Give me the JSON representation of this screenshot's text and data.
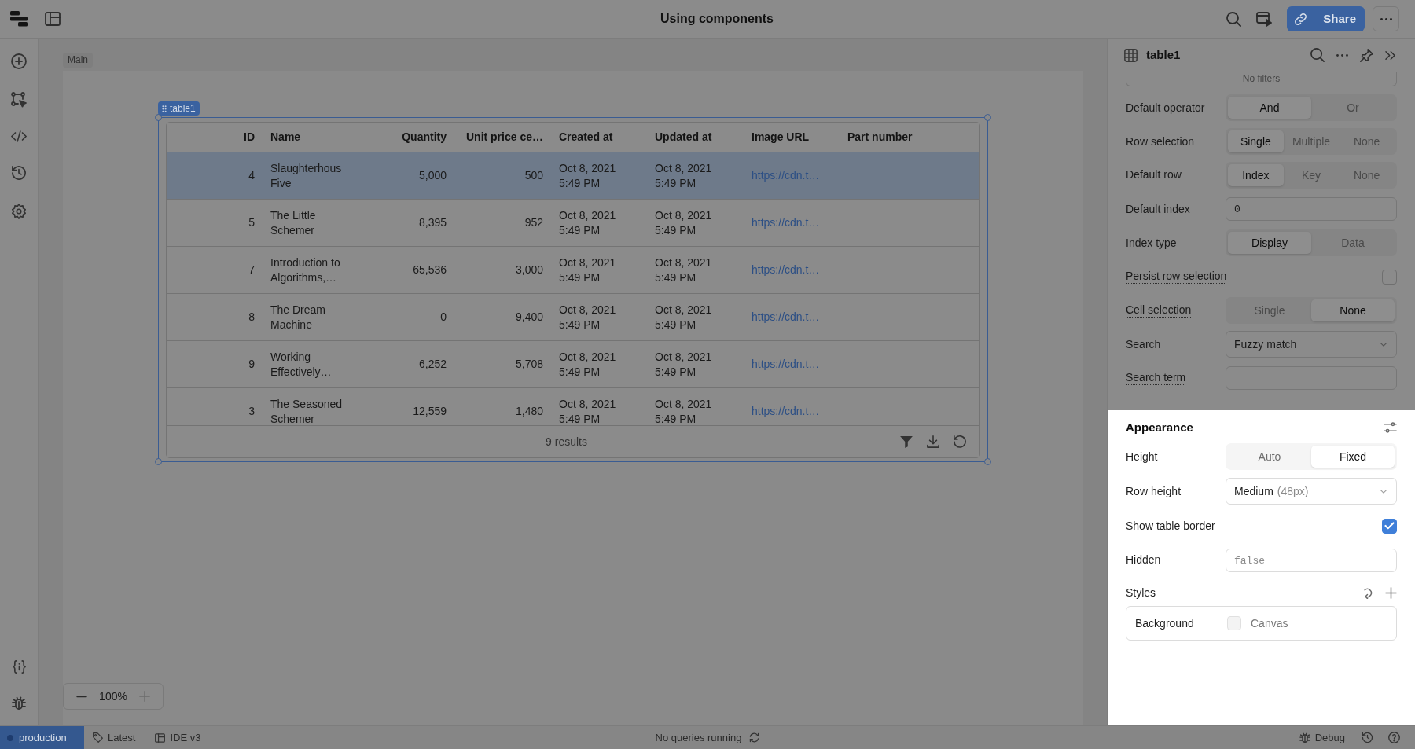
{
  "top_bar": {
    "title": "Using components",
    "share_button": "Share"
  },
  "canvas": {
    "frame_label": "Main",
    "zoom_level": "100%",
    "zoom_in_disabled": true
  },
  "table": {
    "tag": "table1",
    "columns": [
      {
        "label": "ID",
        "kind": "number"
      },
      {
        "label": "Name",
        "kind": "text"
      },
      {
        "label": "Quantity",
        "kind": "number"
      },
      {
        "label": "Unit price ce…",
        "kind": "number"
      },
      {
        "label": "Created at",
        "kind": "text"
      },
      {
        "label": "Updated at",
        "kind": "text"
      },
      {
        "label": "Image URL",
        "kind": "link"
      },
      {
        "label": "Part number",
        "kind": "text"
      }
    ],
    "rows": [
      {
        "selected": true,
        "cells": [
          "4",
          "Slaughterhous\nFive",
          "5,000",
          "500",
          "Oct 8, 2021\n5:49 PM",
          "Oct 8, 2021\n5:49 PM",
          "https://cdn.t…"
        ]
      },
      {
        "selected": false,
        "cells": [
          "5",
          "The Little\nSchemer",
          "8,395",
          "952",
          "Oct 8, 2021\n5:49 PM",
          "Oct 8, 2021\n5:49 PM",
          "https://cdn.t…"
        ]
      },
      {
        "selected": false,
        "cells": [
          "7",
          "Introduction to\nAlgorithms,…",
          "65,536",
          "3,000",
          "Oct 8, 2021\n5:49 PM",
          "Oct 8, 2021\n5:49 PM",
          "https://cdn.t…"
        ]
      },
      {
        "selected": false,
        "cells": [
          "8",
          "The Dream\nMachine",
          "0",
          "9,400",
          "Oct 8, 2021\n5:49 PM",
          "Oct 8, 2021\n5:49 PM",
          "https://cdn.t…"
        ]
      },
      {
        "selected": false,
        "cells": [
          "9",
          "Working\nEffectively…",
          "6,252",
          "5,708",
          "Oct 8, 2021\n5:49 PM",
          "Oct 8, 2021\n5:49 PM",
          "https://cdn.t…"
        ]
      },
      {
        "selected": false,
        "cells": [
          "3",
          "The Seasoned\nSchemer",
          "12,559",
          "1,480",
          "Oct 8, 2021\n5:49 PM",
          "Oct 8, 2021\n5:49 PM",
          "https://cdn.t…"
        ]
      }
    ],
    "footer": "9 results"
  },
  "inspector": {
    "title": "table1",
    "filters": "No filters",
    "settings": [
      {
        "kind": "segmented",
        "label": "Default operator",
        "dotted_underline": false,
        "options": [
          {
            "label": "And",
            "selected": true
          },
          {
            "label": "Or",
            "selected": false
          }
        ]
      },
      {
        "kind": "segmented",
        "label": "Row selection",
        "dotted_underline": false,
        "options": [
          {
            "label": "Single",
            "selected": true
          },
          {
            "label": "Multiple",
            "selected": false
          },
          {
            "label": "None",
            "selected": false
          }
        ]
      },
      {
        "kind": "segmented",
        "label": "Default row",
        "dotted_underline": true,
        "options": [
          {
            "label": "Index",
            "selected": true
          },
          {
            "label": "Key",
            "selected": false
          },
          {
            "label": "None",
            "selected": false
          }
        ]
      },
      {
        "kind": "input",
        "label": "Default index",
        "dotted_underline": false,
        "value": "0"
      },
      {
        "kind": "segmented",
        "label": "Index type",
        "dotted_underline": false,
        "options": [
          {
            "label": "Display",
            "selected": true
          },
          {
            "label": "Data",
            "selected": false
          }
        ]
      },
      {
        "kind": "checkbox",
        "label": "Persist row selection",
        "dotted_underline": true,
        "checked": false
      },
      {
        "kind": "segmented",
        "label": "Cell selection",
        "dotted_underline": true,
        "options": [
          {
            "label": "Single",
            "selected": false
          },
          {
            "label": "None",
            "selected": true
          }
        ]
      },
      {
        "kind": "select",
        "label": "Search",
        "dotted_underline": false,
        "value": "Fuzzy match"
      },
      {
        "kind": "input",
        "label": "Search term",
        "dotted_underline": true
      }
    ],
    "appearance": {
      "spotlight": true,
      "title": "Appearance",
      "settings": [
        {
          "kind": "segmented",
          "label": "Height",
          "dotted_underline": false,
          "options": [
            {
              "label": "Auto",
              "selected": false
            },
            {
              "label": "Fixed",
              "selected": true
            }
          ]
        },
        {
          "kind": "select",
          "label": "Row height",
          "dotted_underline": false,
          "value": "Medium",
          "detail": "(48px)"
        },
        {
          "kind": "checkbox",
          "label": "Show table border",
          "dotted_underline": false,
          "checked": true
        },
        {
          "kind": "input",
          "label": "Hidden",
          "dotted_underline": true,
          "placeholder": "false"
        }
      ],
      "styles": {
        "title": "Styles",
        "items": [
          {
            "label": "Background",
            "value": "Canvas"
          }
        ]
      }
    }
  },
  "status_bar": {
    "environment": "production",
    "release": "Latest",
    "ide_version": "IDE v3",
    "query_status": "No queries running",
    "debug_button": "Debug"
  }
}
